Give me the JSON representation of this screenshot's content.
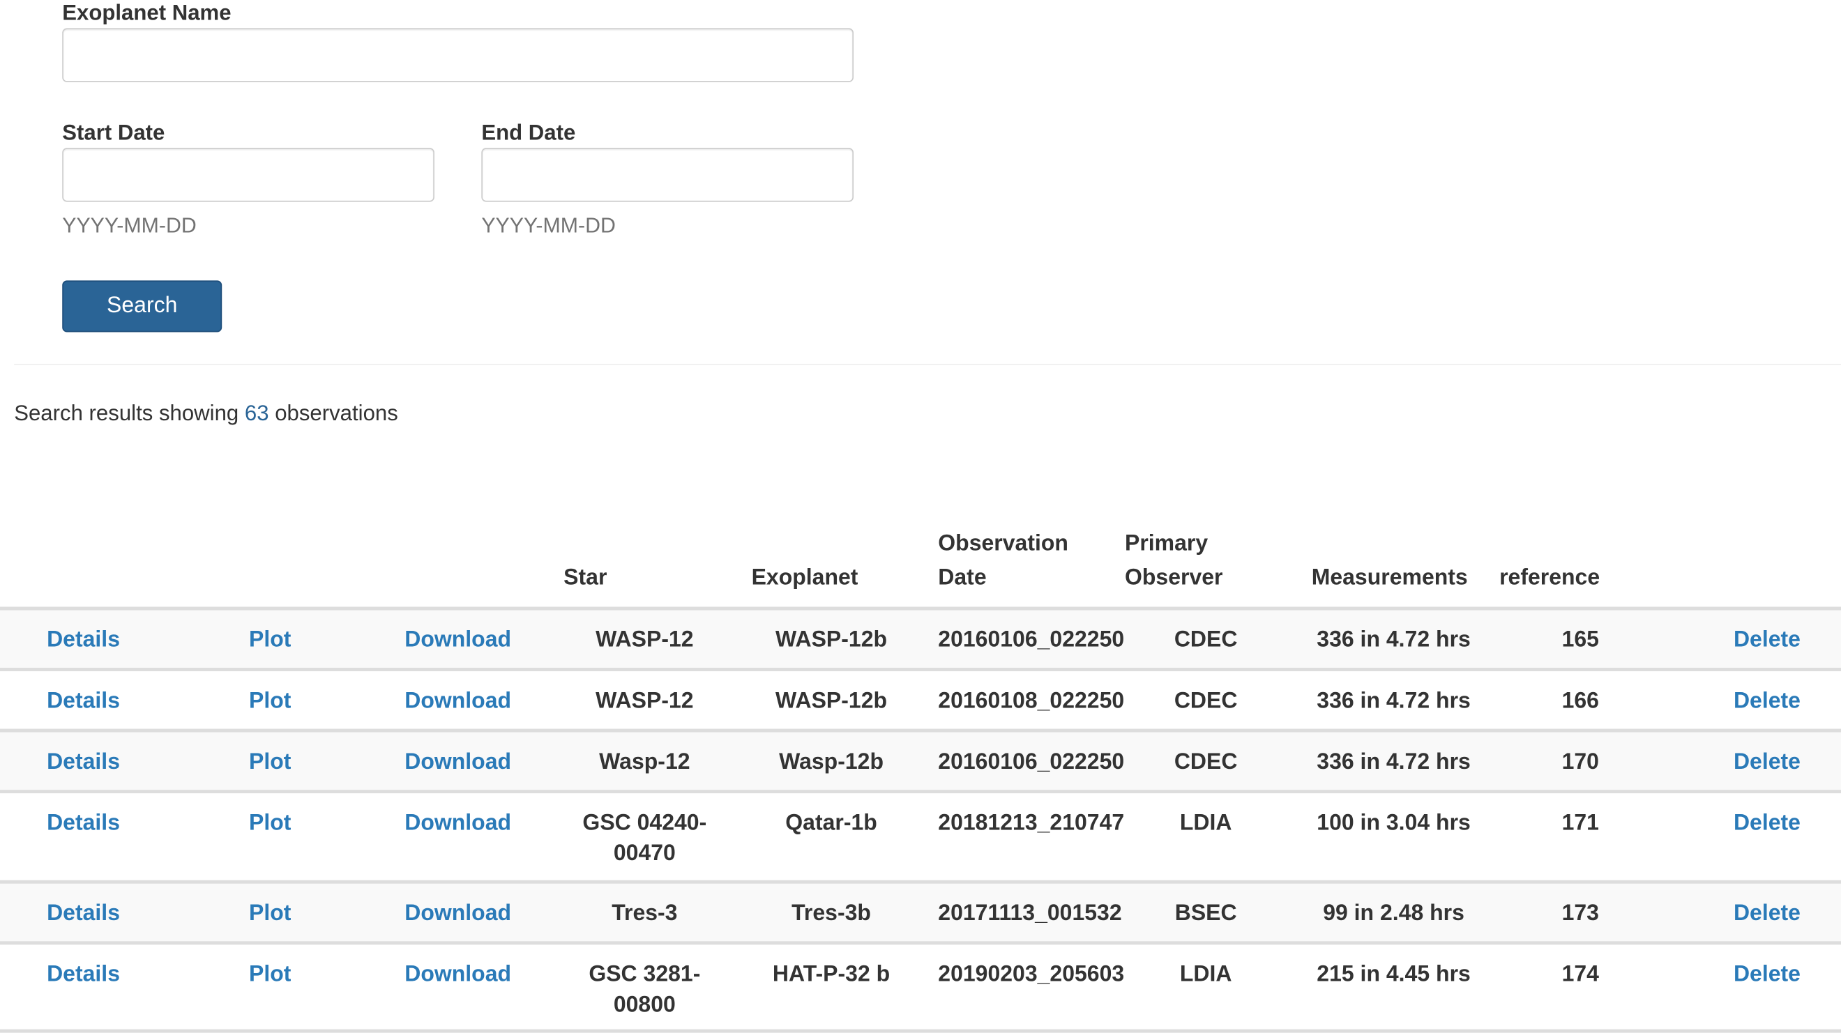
{
  "form": {
    "exoplanet_label": "Exoplanet Name",
    "exoplanet_value": "",
    "start_label": "Start Date",
    "start_value": "",
    "start_help": "YYYY-MM-DD",
    "end_label": "End Date",
    "end_value": "",
    "end_help": "YYYY-MM-DD",
    "search_label": "Search"
  },
  "results": {
    "prefix": "Search results showing",
    "count": "63",
    "suffix": "observations"
  },
  "table": {
    "headers": {
      "star": "Star",
      "exoplanet": "Exoplanet",
      "obs_date_1": "Observation",
      "obs_date_2": "Date",
      "observer_1": "Primary",
      "observer_2": "Observer",
      "measurements": "Measurements",
      "reference": "reference"
    },
    "rows": [
      {
        "details": "Details",
        "plot": "Plot",
        "download": "Download",
        "star": "WASP-12",
        "star2": "",
        "exoplanet": "WASP-12b",
        "date": "20160106_022250",
        "observer": "CDEC",
        "measurements": "336 in 4.72 hrs",
        "reference": "165",
        "delete": "Delete"
      },
      {
        "details": "Details",
        "plot": "Plot",
        "download": "Download",
        "star": "WASP-12",
        "star2": "",
        "exoplanet": "WASP-12b",
        "date": "20160108_022250",
        "observer": "CDEC",
        "measurements": "336 in 4.72 hrs",
        "reference": "166",
        "delete": "Delete"
      },
      {
        "details": "Details",
        "plot": "Plot",
        "download": "Download",
        "star": "Wasp-12",
        "star2": "",
        "exoplanet": "Wasp-12b",
        "date": "20160106_022250",
        "observer": "CDEC",
        "measurements": "336 in 4.72 hrs",
        "reference": "170",
        "delete": "Delete"
      },
      {
        "details": "Details",
        "plot": "Plot",
        "download": "Download",
        "star": "GSC 04240-",
        "star2": "00470",
        "exoplanet": "Qatar-1b",
        "date": "20181213_210747",
        "observer": "LDIA",
        "measurements": "100 in 3.04 hrs",
        "reference": "171",
        "delete": "Delete"
      },
      {
        "details": "Details",
        "plot": "Plot",
        "download": "Download",
        "star": "Tres-3",
        "star2": "",
        "exoplanet": "Tres-3b",
        "date": "20171113_001532",
        "observer": "BSEC",
        "measurements": "99 in 2.48 hrs",
        "reference": "173",
        "delete": "Delete"
      },
      {
        "details": "Details",
        "plot": "Plot",
        "download": "Download",
        "star": "GSC 3281-",
        "star2": "00800",
        "exoplanet": "HAT-P-32 b",
        "date": "20190203_205603",
        "observer": "LDIA",
        "measurements": "215 in 4.45 hrs",
        "reference": "174",
        "delete": "Delete"
      }
    ]
  }
}
